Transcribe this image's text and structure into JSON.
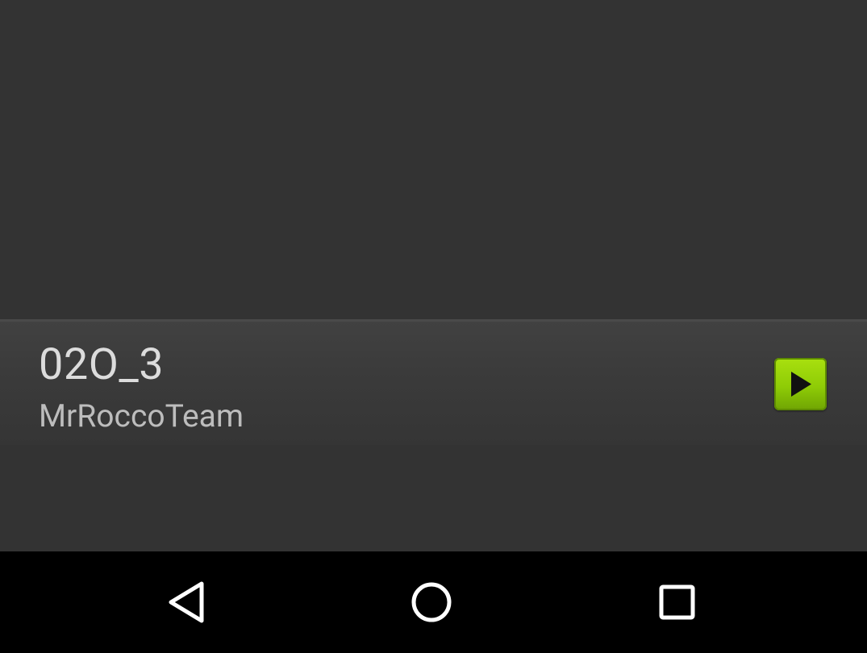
{
  "track": {
    "title": "02O_3",
    "author": "MrRoccoTeam"
  },
  "icons": {
    "play": "play-icon",
    "back": "back-triangle-icon",
    "home": "home-circle-icon",
    "recents": "recents-square-icon"
  },
  "colors": {
    "background": "#333333",
    "card": "#3b3b3b",
    "play_accent": "#9ad60a",
    "nav_bar": "#000000",
    "nav_icon": "#ffffff"
  }
}
